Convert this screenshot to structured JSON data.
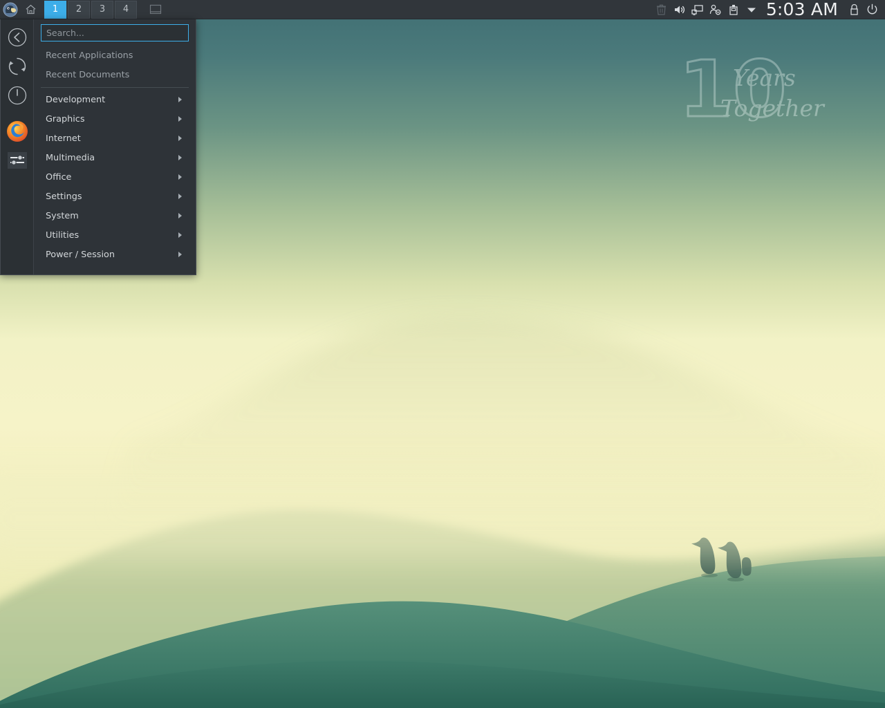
{
  "panel": {
    "menu_button": {
      "icon": "xfce-mouse-icon",
      "tooltip": "Applications"
    },
    "home_button": {
      "icon": "home-icon"
    },
    "workspaces": [
      {
        "label": "1",
        "active": true
      },
      {
        "label": "2",
        "active": false
      },
      {
        "label": "3",
        "active": false
      },
      {
        "label": "4",
        "active": false
      }
    ],
    "show_desktop": {
      "icon": "show-desktop-icon"
    },
    "tray": [
      {
        "name": "trash-icon",
        "label": "Trash"
      },
      {
        "name": "volume-icon",
        "label": "Volume"
      },
      {
        "name": "network-icon",
        "label": "Network"
      },
      {
        "name": "user-status-icon",
        "label": "User"
      },
      {
        "name": "removable-device-icon",
        "label": "Removable media"
      },
      {
        "name": "chevron-down-icon",
        "label": "Show hidden icons"
      }
    ],
    "clock": "5:03 AM",
    "lock": {
      "icon": "lock-icon",
      "label": "Lock screen"
    },
    "power": {
      "icon": "power-icon",
      "label": "Shutdown"
    }
  },
  "appmenu": {
    "search": {
      "placeholder": "Search...",
      "value": ""
    },
    "recent": [
      {
        "label": "Recent Applications"
      },
      {
        "label": "Recent Documents"
      }
    ],
    "categories": [
      {
        "label": "Development"
      },
      {
        "label": "Graphics"
      },
      {
        "label": "Internet"
      },
      {
        "label": "Multimedia"
      },
      {
        "label": "Office"
      },
      {
        "label": "Settings"
      },
      {
        "label": "System"
      },
      {
        "label": "Utilities"
      },
      {
        "label": "Power / Session"
      }
    ],
    "sidebar_actions": [
      {
        "name": "back-icon",
        "label": "Back"
      },
      {
        "name": "restart-icon",
        "label": "Restart"
      },
      {
        "name": "shutdown-icon",
        "label": "Shutdown"
      }
    ],
    "favorites": [
      {
        "name": "firefox-icon",
        "label": "Firefox Web Browser"
      },
      {
        "name": "settings-sliders-icon",
        "label": "Settings Manager"
      }
    ]
  },
  "wallpaper": {
    "watermark_number": "10",
    "watermark_line1": "Years",
    "watermark_line2": "Together",
    "description": "Misty green hills with penguins"
  },
  "colors": {
    "panel_bg": "#31363b",
    "accent": "#3daee9",
    "menu_bg": "#2e3338",
    "menu_sidebar_bg": "#2b3034",
    "text": "#d3d7da",
    "text_dim": "#9aa1a7"
  }
}
